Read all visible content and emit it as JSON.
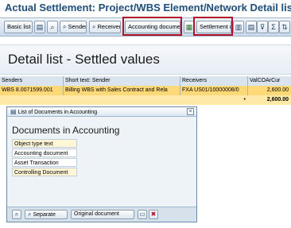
{
  "window": {
    "title": "Actual Settlement: Project/WBS Element/Network Detail list"
  },
  "toolbar": {
    "basic_list": "Basic list",
    "sender": "Sender",
    "receiver": "Receiver",
    "accounting_documents": "Accounting documents",
    "settlement_rule": "Settlement rule"
  },
  "main": {
    "heading": "Detail list - Settled values"
  },
  "table": {
    "columns": [
      "Senders",
      "Short text: Sender",
      "Receivers",
      "ValCOArCur"
    ],
    "rows": [
      {
        "sender": "WBS 8.0071599.001",
        "short_text": "Billing WBS with Sales Contract and Rela",
        "receiver": "FXA US01/10000008/0",
        "value": "2,600.00"
      }
    ],
    "total": {
      "marker": "•",
      "value": "2,600.00"
    }
  },
  "popup": {
    "title": "List of Documents in Accounting",
    "heading": "Documents in Accounting",
    "list_header": "Object type text",
    "items": [
      "Accounting document",
      "Asset Transaction",
      "Controlling Document"
    ],
    "selected_item": "Controlling Document",
    "buttons": {
      "separate": "Separate",
      "original_document": "Original document"
    }
  },
  "colors": {
    "title": "#1f4e79",
    "highlight_box": "#b1122a",
    "row_highlight": "#ffd978",
    "total_row": "#ffe9a8"
  }
}
